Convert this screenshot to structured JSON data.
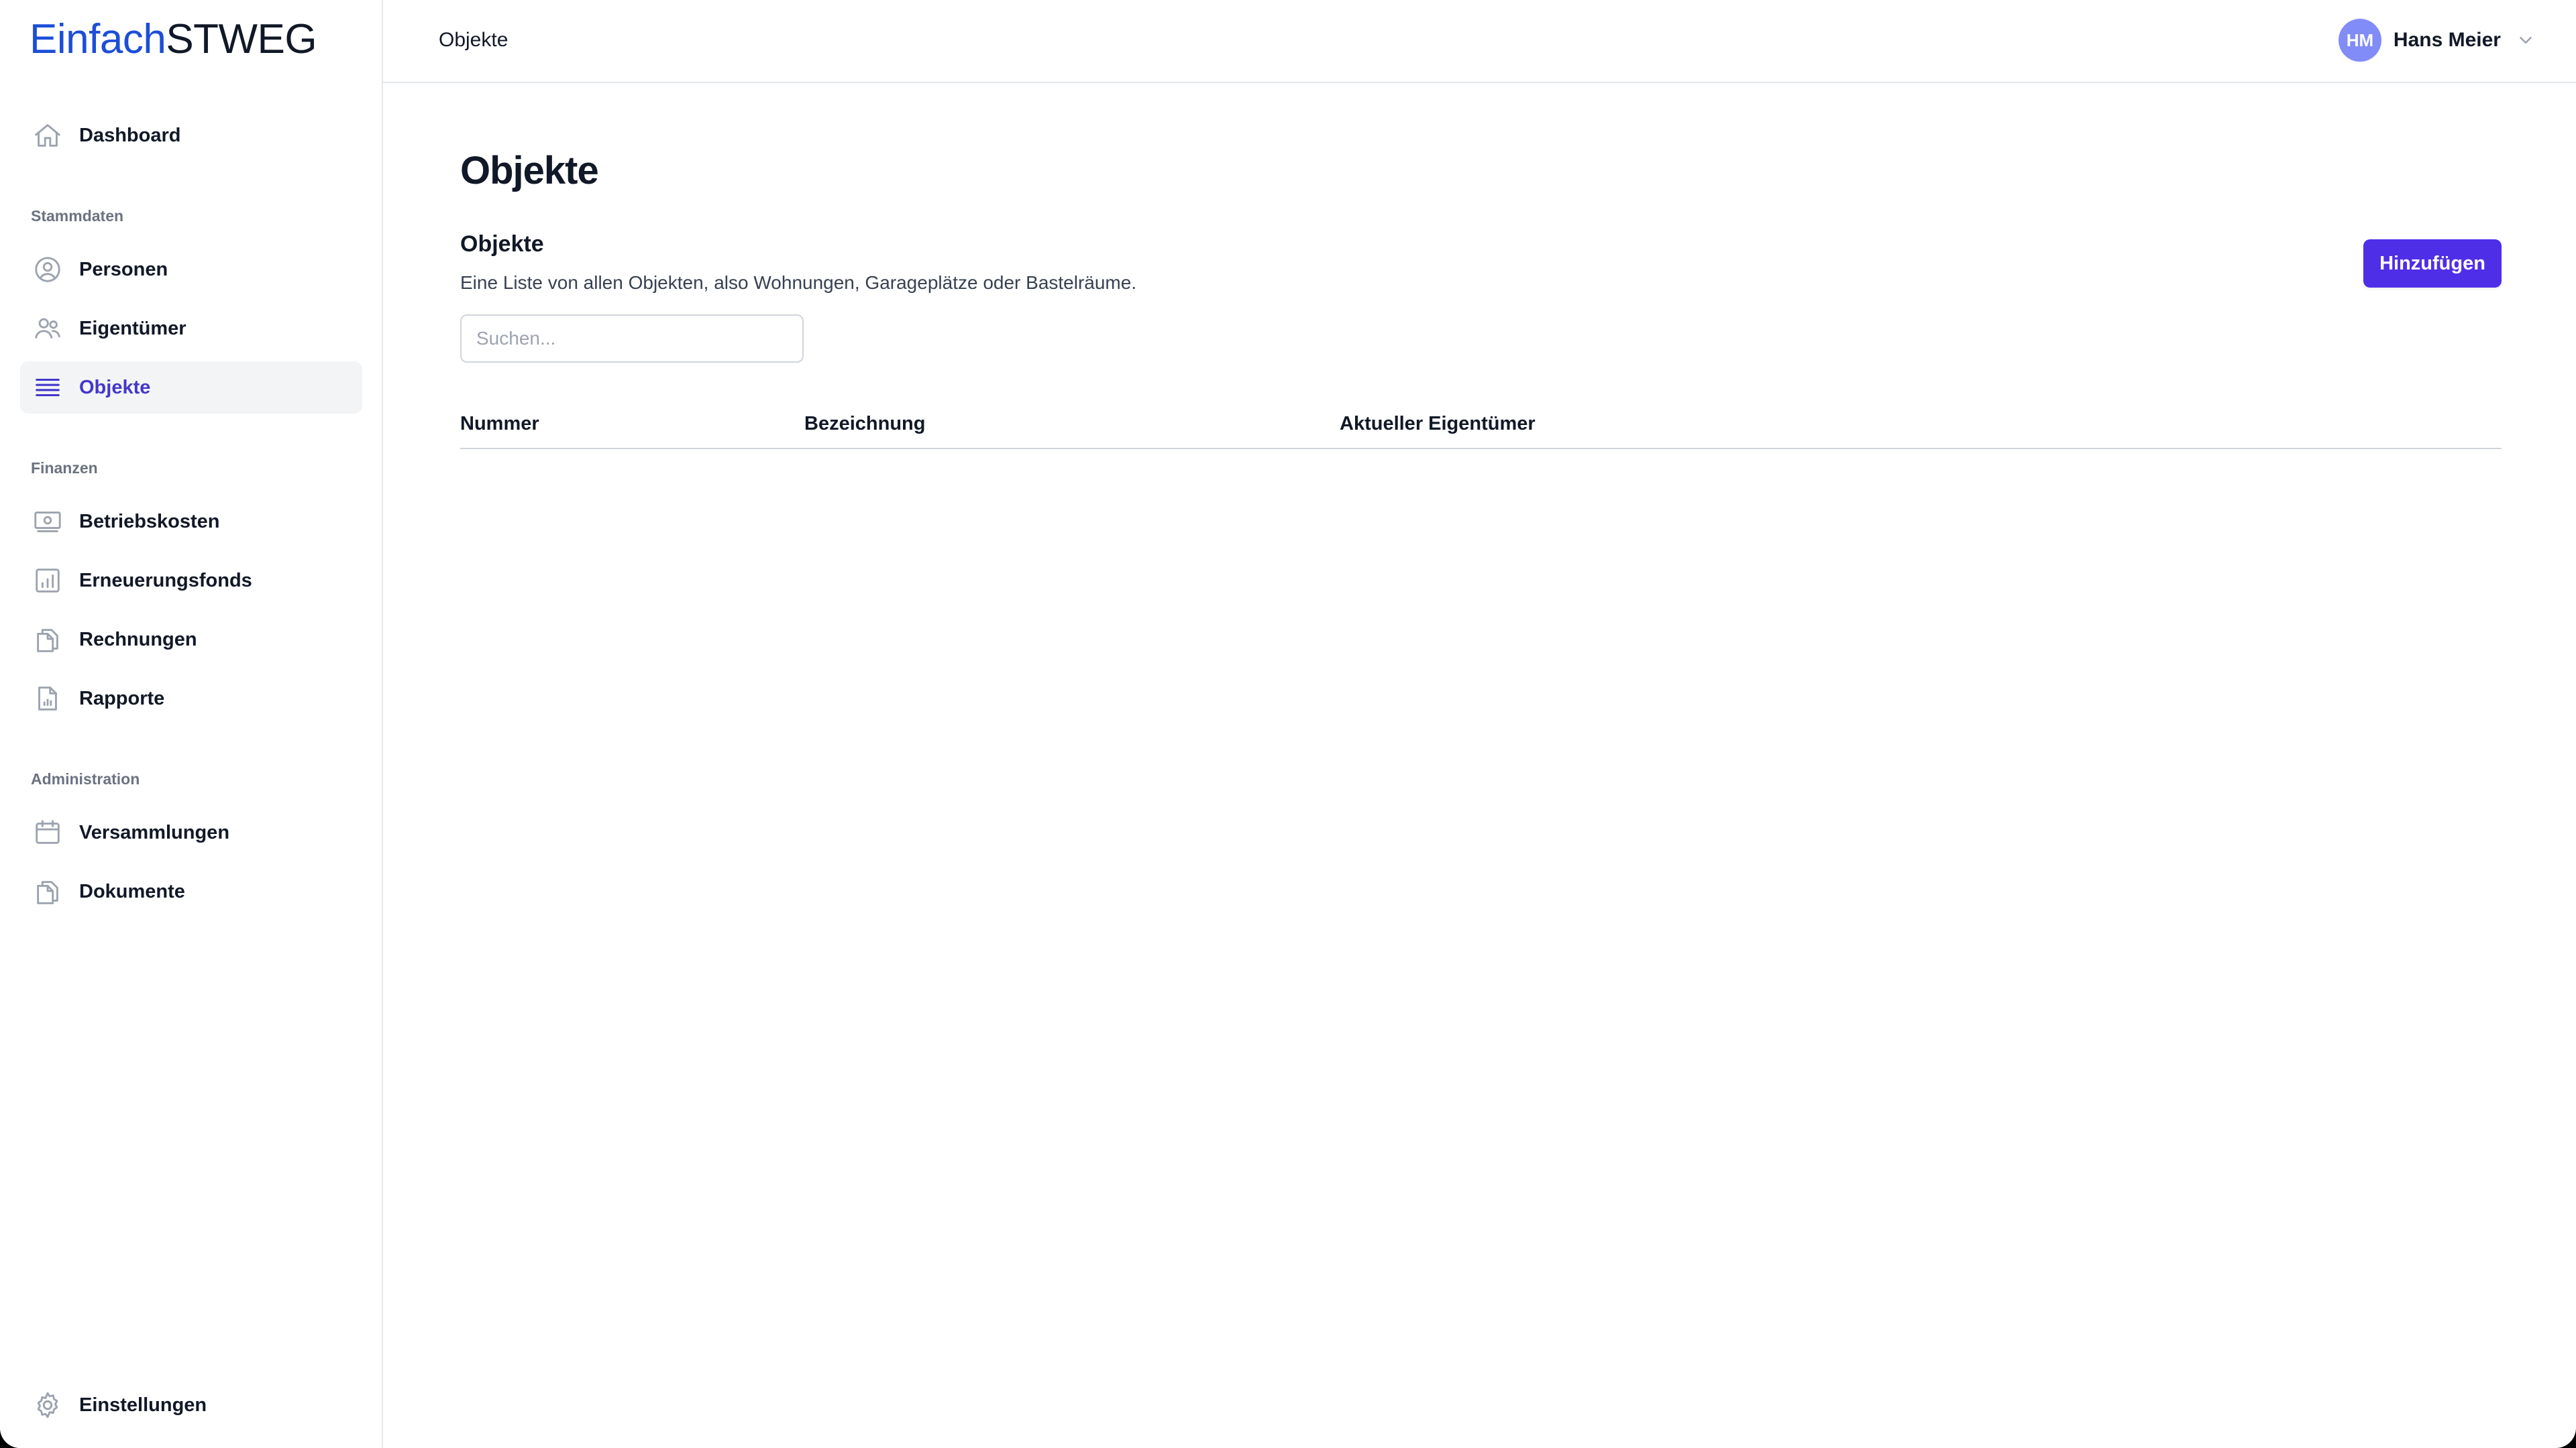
{
  "app": {
    "logo_part1": "Einfach",
    "logo_part2": "STWEG",
    "brand_color": "#1d4ed8",
    "accent_color": "#4f2ee8"
  },
  "sidebar": {
    "dashboard": {
      "label": "Dashboard",
      "icon": "home-icon"
    },
    "sections": [
      {
        "label": "Stammdaten"
      },
      {
        "label": "Finanzen"
      },
      {
        "label": "Administration"
      }
    ],
    "items": [
      {
        "label": "Personen",
        "icon": "user-circle-icon"
      },
      {
        "label": "Eigentümer",
        "icon": "users-icon"
      },
      {
        "label": "Objekte",
        "icon": "list-icon",
        "active": true
      },
      {
        "label": "Betriebskosten",
        "icon": "banknote-icon"
      },
      {
        "label": "Erneuerungsfonds",
        "icon": "bar-chart-icon"
      },
      {
        "label": "Rechnungen",
        "icon": "documents-icon"
      },
      {
        "label": "Rapporte",
        "icon": "report-icon"
      },
      {
        "label": "Versammlungen",
        "icon": "calendar-icon"
      },
      {
        "label": "Dokumente",
        "icon": "documents-icon"
      }
    ],
    "settings": {
      "label": "Einstellungen",
      "icon": "gear-icon"
    }
  },
  "header": {
    "breadcrumb": "Objekte",
    "user": {
      "initials": "HM",
      "name": "Hans Meier"
    }
  },
  "main": {
    "page_title": "Objekte",
    "section_title": "Objekte",
    "section_description": "Eine Liste von allen Objekten, also Wohnungen, Garageplätze oder Bastelräume.",
    "add_button": "Hinzufügen",
    "search": {
      "value": "",
      "placeholder": "Suchen..."
    },
    "table": {
      "columns": [
        "Nummer",
        "Bezeichnung",
        "Aktueller Eigentümer"
      ],
      "rows": []
    }
  }
}
